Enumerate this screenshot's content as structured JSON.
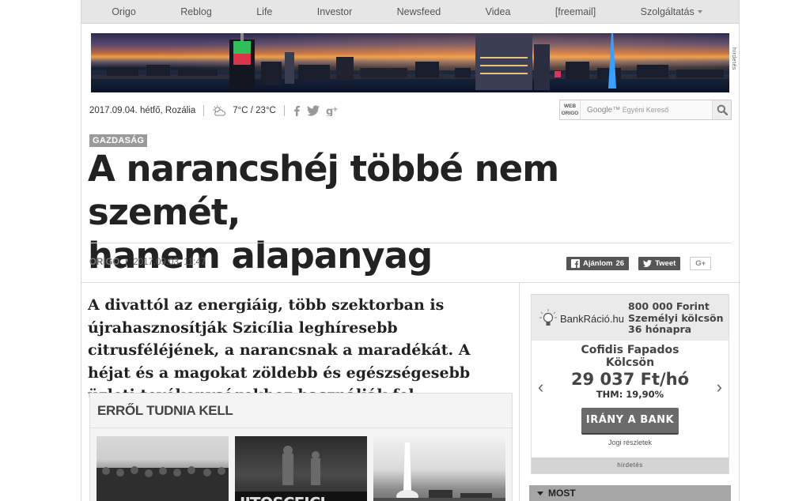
{
  "nav": {
    "items": [
      "Origo",
      "Reblog",
      "Life",
      "Investor",
      "Newsfeed",
      "Videa",
      "[freemail]",
      "Szolgáltatás"
    ]
  },
  "banner": {
    "ad_label": "hirdetés"
  },
  "infobar": {
    "date": "2017.09.04. hétfő, Rozália",
    "weather": "7°C / 23°C",
    "search_tag_line1": "WEB",
    "search_tag_line2": "ORIGO",
    "search_brand": "Google™",
    "search_placeholder": "Egyéni Kereső"
  },
  "article": {
    "category": "GAZDASÁG",
    "headline_line1": "A narancshéj többé nem szemét,",
    "headline_line2": "hanem alapanyag",
    "source": "ORIGO",
    "published": "2017.09.03. 11:47",
    "lead": "A divattól az energiáig, több szektorban is újrahasznosítják Szicília leghíresebb citrusféléjének, a narancsnak a maradékát. A héjat és a magokat zöldebb és egészségesebb üzleti tevékenységekhez használják fel."
  },
  "share": {
    "facebook_label": "Ajánlom",
    "facebook_count": "26",
    "tweet_label": "Tweet",
    "gplus_label": "G+"
  },
  "know": {
    "title": "ERRŐL TUDNIA KELL"
  },
  "ad": {
    "brand": "BankRáció.hu",
    "offer_line1": "800 000 Forint",
    "offer_line2": "Személyi kölcsön",
    "offer_line3": "36 hónapra",
    "product_line1": "Cofidis Fapados",
    "product_line2": "Kölcsön",
    "price": "29 037 Ft/hó",
    "thm": "THM: 19,90%",
    "cta": "IRÁNY A BANK",
    "legal": "Jogi részletek",
    "footer": "hirdetés"
  },
  "most": {
    "label": "MOST"
  },
  "colors": {
    "nav_bg": "#e6e6e6",
    "category_bg": "#9a9a9a",
    "cta_bg": "#6b6b6b"
  }
}
